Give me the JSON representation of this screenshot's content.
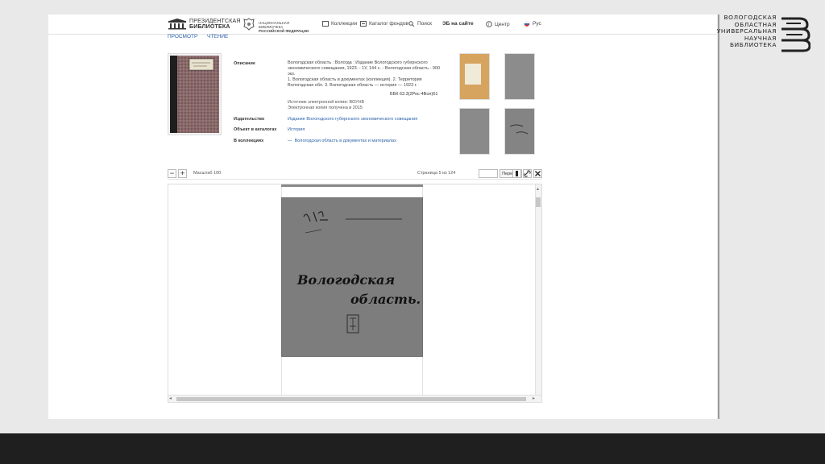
{
  "logo": {
    "lines": [
      "ВОЛОГОДСКАЯ",
      "ОБЛАСТНАЯ",
      "УНИВЕРСАЛЬНАЯ",
      "НАУЧНАЯ",
      "БИБЛИОТЕКА"
    ]
  },
  "site": {
    "brand_line1": "ПРЕЗИДЕНТСКАЯ",
    "brand_line2": "БИБЛИОТЕКА",
    "rgb_line1": "НАЦИОНАЛЬНАЯ БИБЛИОТЕКА",
    "rgb_line2": "РОССИЙСКОЙ ФЕДЕРАЦИИ",
    "nav": {
      "collections": "Коллекции",
      "catalog": "Каталог фондов",
      "search": "Поиск",
      "hall": "ЭБ на сайте",
      "help": "Центр",
      "lang": "Рус"
    },
    "tabs": [
      "ПРОСМОТР",
      "ЧТЕНИЕ"
    ]
  },
  "meta": {
    "description_label": "Описание",
    "description_text": "Вологодская область : Вологда : Издание Вологодского губернского экономического совещания, 1923. - 1У, 144 с. - Вологодская область - 900 экз.",
    "description_text2": "1. Вологодская область в документах (коллекция). 2. Территория Вологодская обл. 3. Вологодская область — история — 1923 г.",
    "bbk": "ББК 63.3(2Рос-4Вол)61",
    "source_text": "Источник электронной копии: ВОУНБ",
    "source_text2": "Электронная копия получена в 2015",
    "publisher_label": "Издательство",
    "publisher_value": "Издание Вологодского губернского экономического совещания",
    "catalog_label": "Объект в каталогах",
    "catalog_value": "История",
    "collection_label": "В коллекциях",
    "collection_value": "Вологодская область в документах и материалах"
  },
  "viewer": {
    "zoom_minus": "−",
    "zoom_plus": "+",
    "zoom_text": "Масштаб 100",
    "page_text": "Страница 5 из 124",
    "page_input": "",
    "go_button": "Перейти",
    "page_title_1": "Вологодская",
    "page_title_2": "область."
  },
  "colors": {
    "link": "#2a61a8",
    "page": "#7b7b7b",
    "footer": "#1f1f1f"
  }
}
